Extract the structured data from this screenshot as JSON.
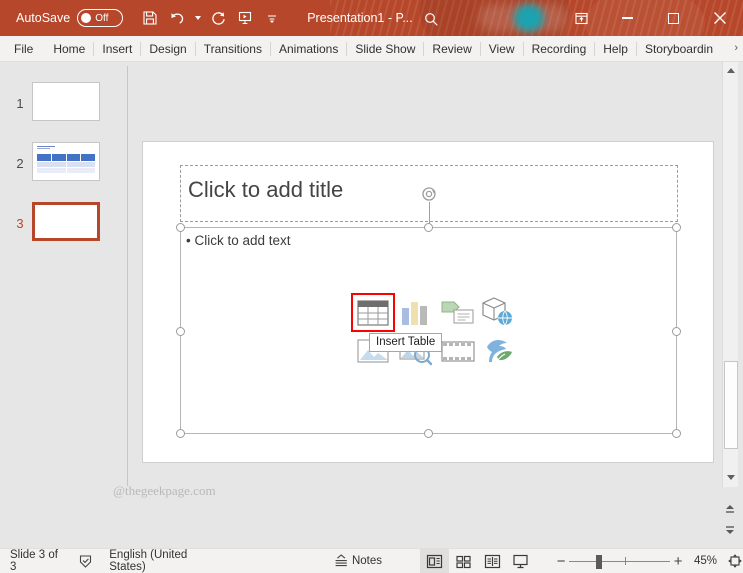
{
  "titlebar": {
    "autosave_label": "AutoSave",
    "autosave_state": "Off",
    "document_title": "Presentation1  -  P...",
    "icons": {
      "save": "save-icon",
      "undo": "undo-icon",
      "redo": "redo-icon",
      "slideshow": "start-slideshow-icon",
      "customize": "customize-quick-access-toolbar-icon",
      "search": "search-icon",
      "ribbon_display": "ribbon-display-options-icon",
      "minimize": "minimize-icon",
      "maximize": "maximize-icon",
      "close": "close-icon"
    },
    "accent_color": "#b7472a",
    "avatar_color": "#1aa3b0"
  },
  "ribbon": {
    "tabs": [
      {
        "label": "File"
      },
      {
        "label": "Home"
      },
      {
        "label": "Insert"
      },
      {
        "label": "Design"
      },
      {
        "label": "Transitions"
      },
      {
        "label": "Animations"
      },
      {
        "label": "Slide Show"
      },
      {
        "label": "Review"
      },
      {
        "label": "View"
      },
      {
        "label": "Recording"
      },
      {
        "label": "Help"
      },
      {
        "label": "Storyboardin"
      }
    ],
    "overflow_indicator": "›"
  },
  "thumbnails": [
    {
      "number": "1",
      "selected": false,
      "has_table": false
    },
    {
      "number": "2",
      "selected": false,
      "has_table": true
    },
    {
      "number": "3",
      "selected": true,
      "has_table": false
    }
  ],
  "slide": {
    "title_placeholder": "Click to add title",
    "body_placeholder": "Click to add text",
    "body_bullet": "•",
    "watermark": "@thegeekpage.com",
    "rotation_handle": "rotation-handle-icon",
    "content_icons": [
      {
        "name": "insert-table-icon",
        "label": "Insert Table",
        "selected": true
      },
      {
        "name": "insert-chart-icon",
        "label": "Insert Chart",
        "selected": false
      },
      {
        "name": "insert-smartart-icon",
        "label": "Insert a SmartArt Graphic",
        "selected": false
      },
      {
        "name": "insert-3d-model-icon",
        "label": "Insert 3D Model",
        "selected": false
      },
      {
        "name": "insert-pictures-icon",
        "label": "Pictures",
        "selected": false
      },
      {
        "name": "insert-stock-images-icon",
        "label": "Stock Images",
        "selected": false
      },
      {
        "name": "insert-video-icon",
        "label": "Insert Video",
        "selected": false
      },
      {
        "name": "insert-icons-icon",
        "label": "Icons",
        "selected": false
      }
    ],
    "tooltip": "Insert Table",
    "selection_highlight_color": "#ff0000"
  },
  "statusbar": {
    "slide_counter": "Slide 3 of 3",
    "accessibility_icon": "accessibility-checker-icon",
    "language": "English (United States)",
    "notes_label": "Notes",
    "notes_icon": "notes-icon",
    "views": [
      {
        "name": "normal-view-button",
        "label": "Normal",
        "active": true
      },
      {
        "name": "slide-sorter-view-button",
        "label": "Slide Sorter",
        "active": false
      },
      {
        "name": "reading-view-button",
        "label": "Reading View",
        "active": false
      },
      {
        "name": "slide-show-button",
        "label": "Slide Show",
        "active": false
      }
    ],
    "zoom_out": "−",
    "zoom_in": "+",
    "zoom_level": "45%",
    "fit_icon": "fit-slide-to-window-icon"
  },
  "scrollbar": {
    "up": "scroll-up-icon",
    "down": "scroll-down-icon",
    "previous_slide": "previous-slide-icon",
    "next_slide": "next-slide-icon"
  }
}
